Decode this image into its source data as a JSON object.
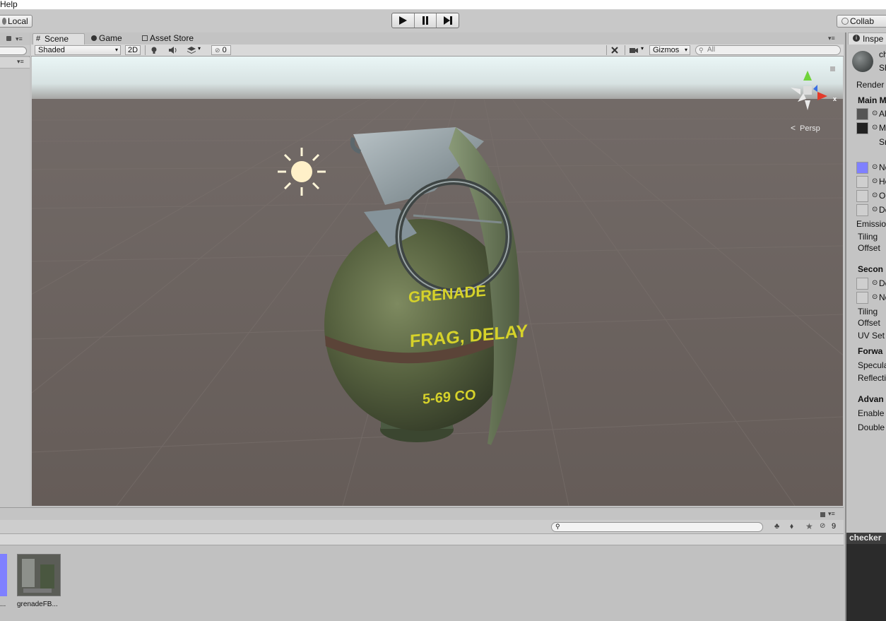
{
  "menu": {
    "help_label": "Help"
  },
  "toolbar": {
    "local_label": "Local",
    "collab_label": "Collab"
  },
  "scene": {
    "tabs": [
      {
        "label": "Scene"
      },
      {
        "label": "Game"
      },
      {
        "label": "Asset Store"
      }
    ],
    "shading_mode": "Shaded",
    "mode_2d_label": "2D",
    "hidden_count": "0",
    "gizmos_label": "Gizmos",
    "search_placeholder": "All",
    "persp_label": "Persp",
    "axis_x_label": "x",
    "object_text": {
      "line1": "GRENADE",
      "line2": "FRAG, DELAY",
      "line3": "5-69 CO"
    }
  },
  "inspector": {
    "tab_label": "Inspe",
    "material_name": "ch",
    "shader_short": "Sh",
    "rendering_label": "Render",
    "main_maps_label": "Main M",
    "albedo_label": "Al",
    "metallic_label": "Me",
    "smoothness_label": "Sr",
    "normal_label": "No",
    "height_label": "He",
    "occlusion_label": "Oc",
    "detail_mask_label": "De",
    "emission_label": "Emissio",
    "tiling_label": "Tiling",
    "offset_label": "Offset",
    "secondary_label": "Secon",
    "detail_albedo_label": "De",
    "detail_normal_label": "No",
    "tiling2_label": "Tiling",
    "offset2_label": "Offset",
    "uvset_label": "UV Set",
    "forward_label": "Forwa",
    "specular_label": "Specula",
    "reflections_label": "Reflectio",
    "advanced_label": "Advan",
    "enable_label": "Enable",
    "double_label": "Double"
  },
  "project": {
    "hidden_count": "9",
    "asset_label_partial": "...",
    "asset_name": "grenadeFB..."
  },
  "preview": {
    "title": "checker"
  },
  "colors": {
    "viewport_ground": "#665e5a",
    "grenade_body": "#4f5a3c",
    "grenade_text": "#d6d22a",
    "normal_map_swatch": "#7f80ff"
  }
}
